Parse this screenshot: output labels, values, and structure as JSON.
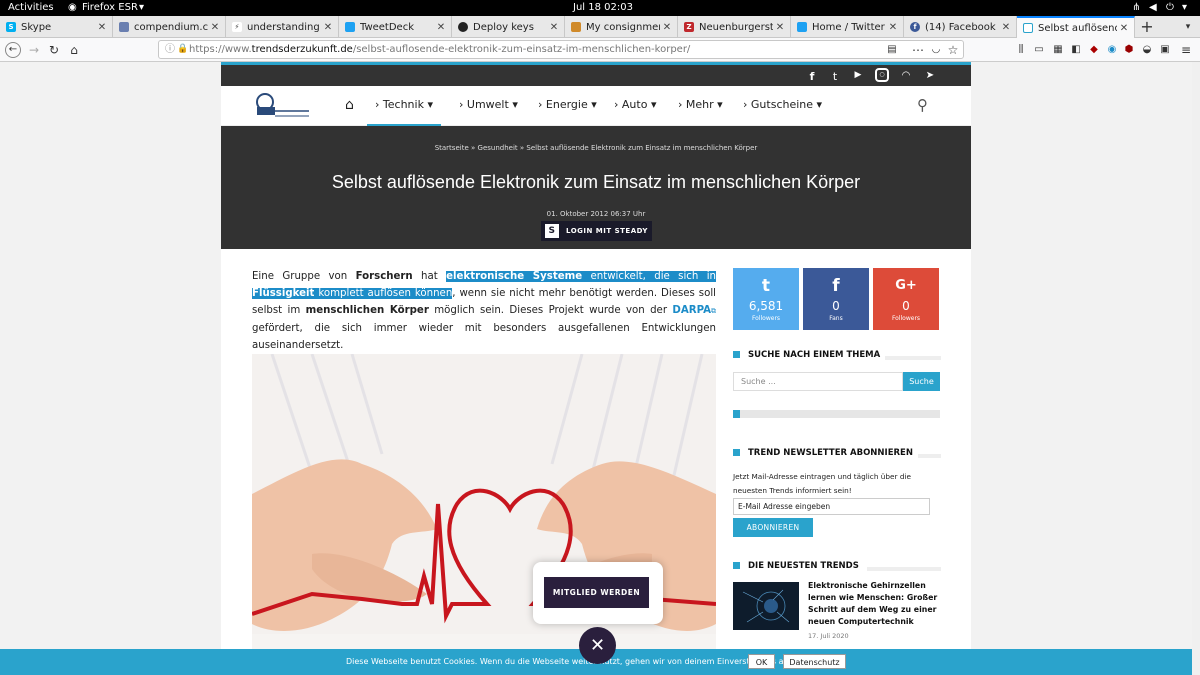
{
  "system": {
    "activities": "Activities",
    "app": "Firefox ESR",
    "clock": "Jul 18  02:03"
  },
  "tabs": [
    {
      "label": "Skype",
      "icon": "skype-icon",
      "color": "#00aff0"
    },
    {
      "label": "compendium.ch",
      "icon": "page-icon",
      "color": "#6a7fb0"
    },
    {
      "label": "understanding - na",
      "icon": "bolt-icon",
      "color": "#444444"
    },
    {
      "label": "TweetDeck",
      "icon": "tweetdeck-icon",
      "color": "#1da1f2"
    },
    {
      "label": "Deploy keys",
      "icon": "github-icon",
      "color": "#222222"
    },
    {
      "label": "My consignments",
      "icon": "consignment-icon",
      "color": "#d08a2a"
    },
    {
      "label": "Neuenburgerstra",
      "icon": "z-icon",
      "color": "#c0282d"
    },
    {
      "label": "Home / Twitter",
      "icon": "twitter-icon",
      "color": "#1da1f2"
    },
    {
      "label": "(14) Facebook",
      "icon": "facebook-icon",
      "color": "#3b5998"
    },
    {
      "label": "Selbst auflösende",
      "icon": "site-icon",
      "color": "#2aa3cc"
    }
  ],
  "url": {
    "prefix": "https://www.",
    "domain": "trendsderzukunft.de",
    "path": "/selbst-auflosende-elektronik-zum-einsatz-im-menschlichen-korper/"
  },
  "nav": {
    "items": [
      "Technik",
      "Umwelt",
      "Energie",
      "Auto",
      "Mehr",
      "Gutscheine"
    ]
  },
  "hero": {
    "crumbs": [
      "Startseite",
      "Gesundheit",
      "Selbst auflösende Elektronik zum Einsatz im menschlichen Körper"
    ],
    "title": "Selbst auflösende Elektronik zum Einsatz im menschlichen Körper",
    "date": "01. Oktober 2012 06:37 Uhr",
    "steady": "LOGIN MIT STEADY",
    "steady_logo": "S"
  },
  "article": {
    "p1": "Eine Gruppe von ",
    "b1": "Forschern",
    "p2": " hat ",
    "h1": "elektronische Systeme",
    "h2": " entwickelt, die sich in ",
    "h3": "Flüssigkeit",
    "h4": " komplett auflösen können",
    "p3": ", wenn sie nicht mehr benötigt werden. Dieses soll selbst im ",
    "b2": "menschlichen Körper",
    "p4": " möglich sein. Dieses Projekt wurde von der ",
    "link": "DARPA",
    "p5": " gefördert, die sich immer wieder mit besonders ausgefallenen Entwicklungen auseinandersetzt."
  },
  "social": [
    {
      "icon": "twitter-icon",
      "glyph": "t",
      "count": "6,581",
      "label": "Followers",
      "color": "#55acee"
    },
    {
      "icon": "facebook-icon",
      "glyph": "f",
      "count": "0",
      "label": "Fans",
      "color": "#3b5998"
    },
    {
      "icon": "googleplus-icon",
      "glyph": "G+",
      "count": "0",
      "label": "Followers",
      "color": "#dd4b39"
    }
  ],
  "sidebar": {
    "search_title": "SUCHE NACH EINEM THEMA",
    "search_placeholder": "Suche ...",
    "search_button": "Suche",
    "newsletter_title": "TREND NEWSLETTER ABONNIEREN",
    "newsletter_text": "Jetzt Mail-Adresse eintragen und täglich über die neuesten Trends informiert sein!",
    "email_value": "E-Mail Adresse eingeben",
    "subscribe": "ABONNIEREN",
    "trends_title": "DIE NEUESTEN TRENDS",
    "trend_title": "Elektronische Gehirnzellen lernen wie Menschen: Großer Schritt auf dem Weg zu einer neuen Computertechnik",
    "trend_date": "17. Juli 2020"
  },
  "member": "MITGLIED WERDEN",
  "cookie": {
    "text": "Diese Webseite benutzt Cookies. Wenn du die Webseite weiter nutzt, gehen wir von deinem Einverständnis aus.",
    "ok": "OK",
    "privacy": "Datenschutz"
  },
  "accent": "#2aa3cc"
}
